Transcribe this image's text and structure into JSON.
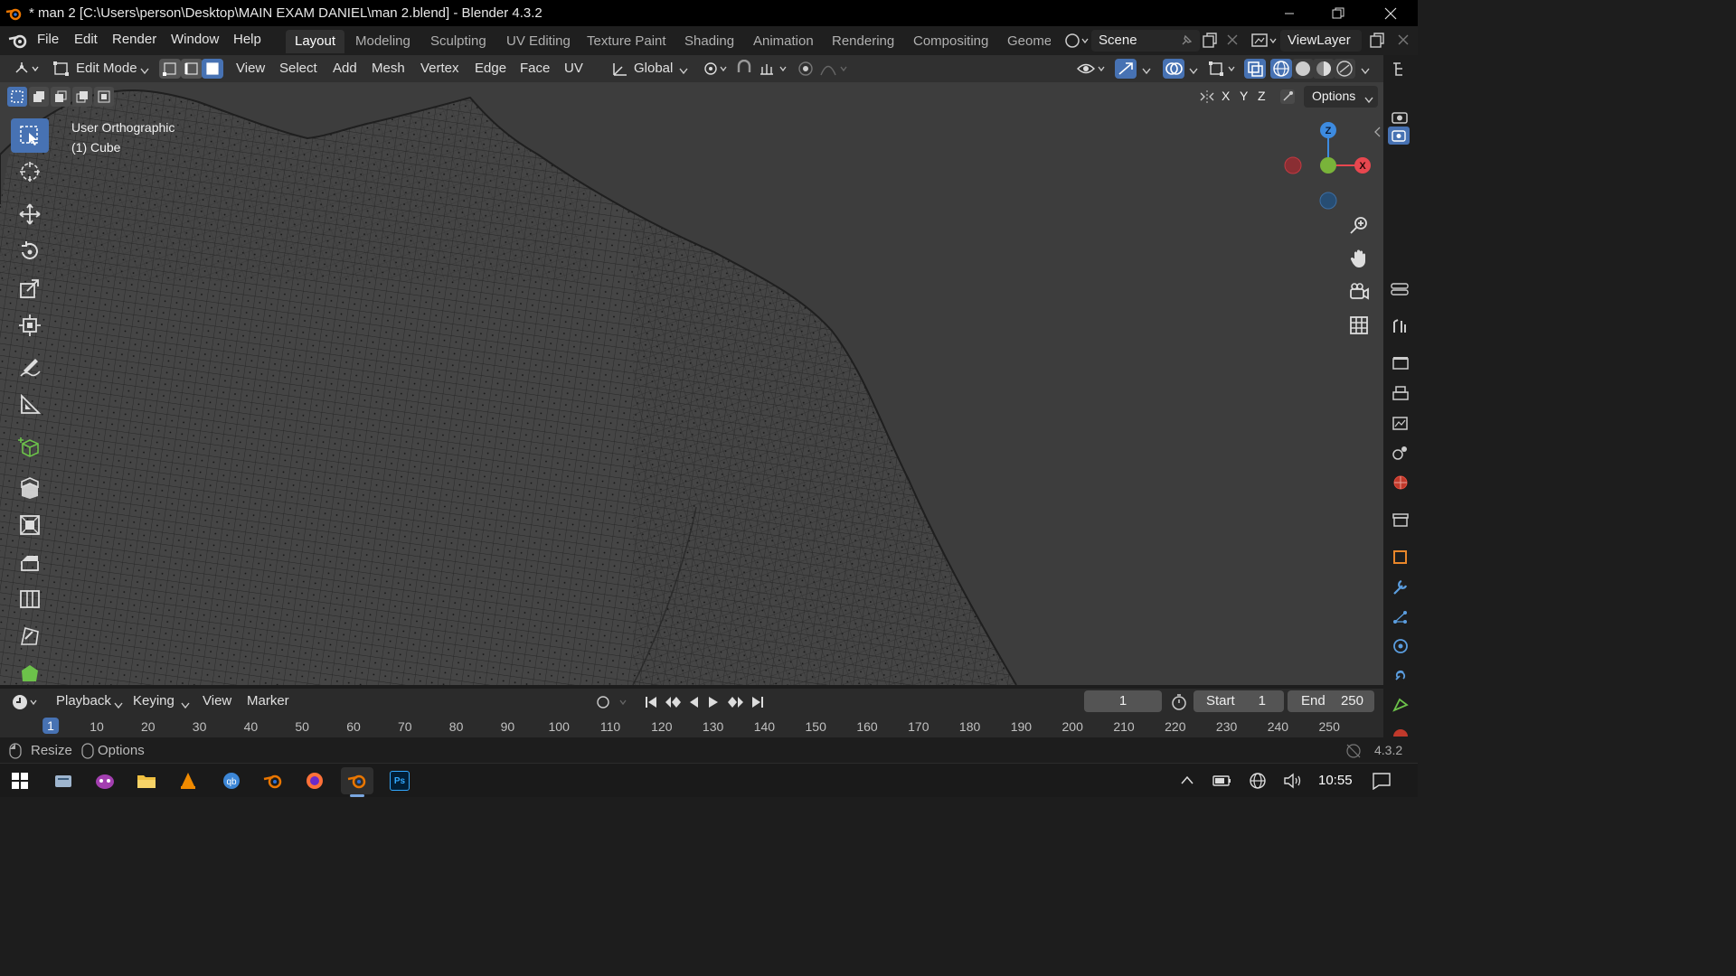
{
  "window": {
    "title": "* man 2 [C:\\Users\\person\\Desktop\\MAIN EXAM DANIEL\\man 2.blend] - Blender 4.3.2",
    "controls": [
      "minimize-icon",
      "restore-icon",
      "close-icon"
    ]
  },
  "menubar": {
    "items": [
      "File",
      "Edit",
      "Render",
      "Window",
      "Help"
    ],
    "workspaces": [
      "Layout",
      "Modeling",
      "Sculpting",
      "UV Editing",
      "Texture Paint",
      "Shading",
      "Animation",
      "Rendering",
      "Compositing",
      "Geomet"
    ],
    "active_workspace": "Layout",
    "scene": "Scene",
    "view_layer": "ViewLayer"
  },
  "header3d": {
    "mode": "Edit Mode",
    "menus": [
      "View",
      "Select",
      "Add",
      "Mesh",
      "Vertex",
      "Edge",
      "Face",
      "UV"
    ],
    "transform_orientation": "Global",
    "options_label": "Options",
    "axes": [
      "X",
      "Y",
      "Z"
    ]
  },
  "viewport": {
    "view_name": "User Orthographic",
    "object_name": "(1) Cube",
    "gizmo": {
      "z": "Z",
      "x": "X"
    }
  },
  "toolbar": {
    "tools": [
      "select-box-icon",
      "cursor-icon",
      "move-icon",
      "rotate-icon",
      "scale-icon",
      "transform-icon",
      "annotate-icon",
      "measure-icon",
      "add-cube-icon",
      "extrude-icon",
      "inset-icon",
      "bevel-icon",
      "loop-cut-icon",
      "knife-icon",
      "poly-build-icon"
    ],
    "active_tool": "select-box-icon"
  },
  "timeline": {
    "menus": [
      "Playback",
      "Keying",
      "View",
      "Marker"
    ],
    "current_frame": "1",
    "start_label": "Start",
    "start_value": "1",
    "end_label": "End",
    "end_value": "250",
    "ruler_ticks": [
      "1",
      "10",
      "20",
      "30",
      "40",
      "50",
      "60",
      "70",
      "80",
      "90",
      "100",
      "110",
      "120",
      "130",
      "140",
      "150",
      "160",
      "170",
      "180",
      "190",
      "200",
      "210",
      "220",
      "230",
      "240",
      "250"
    ]
  },
  "statusbar": {
    "left_items": [
      "Resize",
      "Options"
    ],
    "version": "4.3.2"
  },
  "taskbar": {
    "apps": [
      "windows-start-icon",
      "file-explorer-icon",
      "game-icon",
      "folder-icon",
      "vlc-icon",
      "qbittorrent-icon",
      "blender-icon",
      "firefox-icon",
      "blender-active-icon",
      "photoshop-icon"
    ],
    "photoshop_label": "Ps",
    "time": "10:55"
  },
  "colors": {
    "accent_blue": "#4772b3",
    "axis_x": "#e8474f",
    "axis_y": "#79b33a",
    "axis_z": "#3d8be0",
    "viewport_bg": "#3d3d3d"
  }
}
